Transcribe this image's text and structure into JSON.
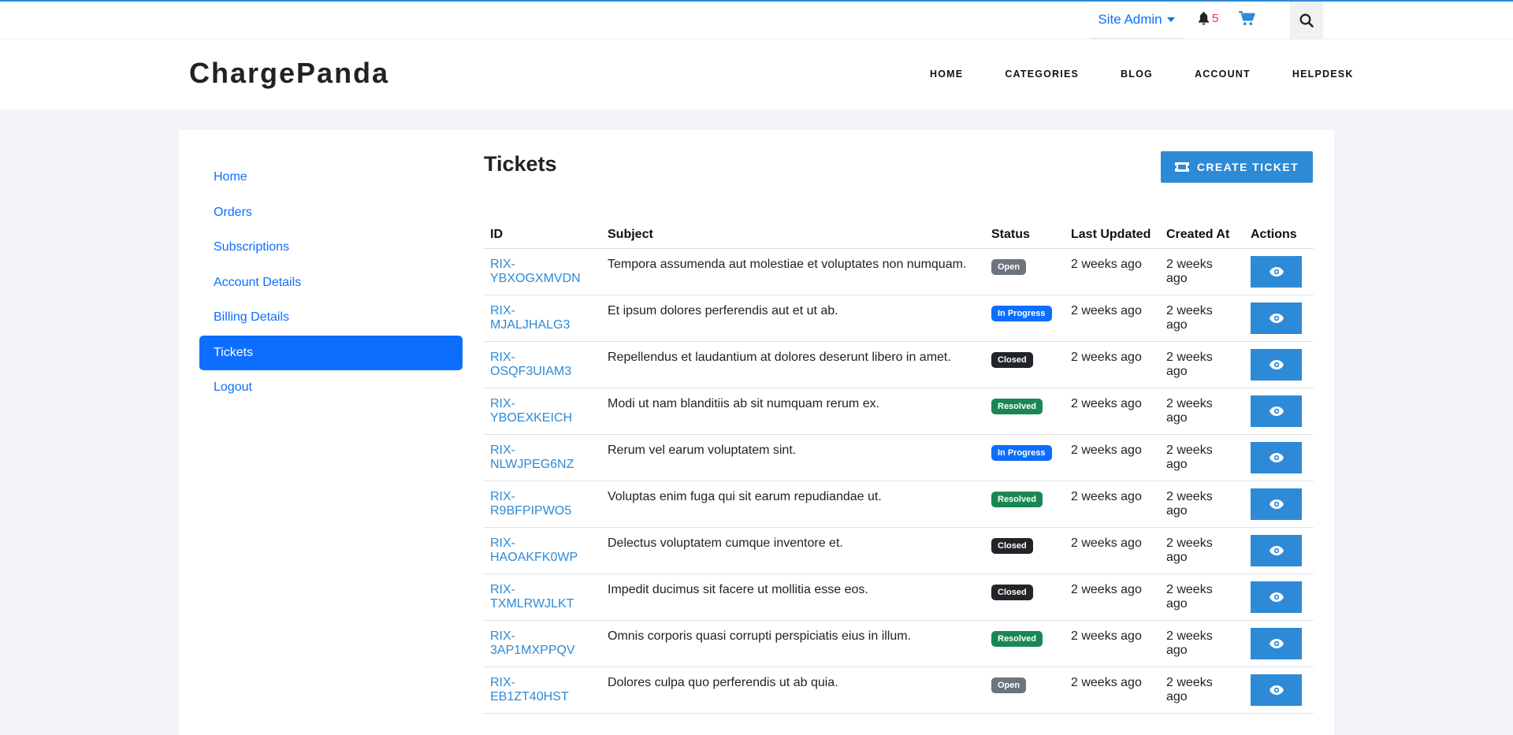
{
  "topbar": {
    "user_menu": "Site Admin",
    "notification_count": "5"
  },
  "header": {
    "logo": "ChargePanda",
    "nav": [
      "HOME",
      "CATEGORIES",
      "BLOG",
      "ACCOUNT",
      "HELPDESK"
    ]
  },
  "sidebar": {
    "items": [
      {
        "label": "Home",
        "active": false
      },
      {
        "label": "Orders",
        "active": false
      },
      {
        "label": "Subscriptions",
        "active": false
      },
      {
        "label": "Account Details",
        "active": false
      },
      {
        "label": "Billing Details",
        "active": false
      },
      {
        "label": "Tickets",
        "active": true
      },
      {
        "label": "Logout",
        "active": false
      }
    ]
  },
  "main": {
    "title": "Tickets",
    "create_button": "CREATE TICKET",
    "columns": [
      "ID",
      "Subject",
      "Status",
      "Last Updated",
      "Created At",
      "Actions"
    ],
    "rows": [
      {
        "id": "RIX-YBXOGXMVDN",
        "subject": "Tempora assumenda aut molestiae et voluptates non numquam.",
        "status": "Open",
        "updated": "2 weeks ago",
        "created": "2 weeks ago"
      },
      {
        "id": "RIX-MJALJHALG3",
        "subject": "Et ipsum dolores perferendis aut et ut ab.",
        "status": "In Progress",
        "updated": "2 weeks ago",
        "created": "2 weeks ago"
      },
      {
        "id": "RIX-OSQF3UIAM3",
        "subject": "Repellendus et laudantium at dolores deserunt libero in amet.",
        "status": "Closed",
        "updated": "2 weeks ago",
        "created": "2 weeks ago"
      },
      {
        "id": "RIX-YBOEXKEICH",
        "subject": "Modi ut nam blanditiis ab sit numquam rerum ex.",
        "status": "Resolved",
        "updated": "2 weeks ago",
        "created": "2 weeks ago"
      },
      {
        "id": "RIX-NLWJPEG6NZ",
        "subject": "Rerum vel earum voluptatem sint.",
        "status": "In Progress",
        "updated": "2 weeks ago",
        "created": "2 weeks ago"
      },
      {
        "id": "RIX-R9BFPIPWO5",
        "subject": "Voluptas enim fuga qui sit earum repudiandae ut.",
        "status": "Resolved",
        "updated": "2 weeks ago",
        "created": "2 weeks ago"
      },
      {
        "id": "RIX-HAOAKFK0WP",
        "subject": "Delectus voluptatem cumque inventore et.",
        "status": "Closed",
        "updated": "2 weeks ago",
        "created": "2 weeks ago"
      },
      {
        "id": "RIX-TXMLRWJLKT",
        "subject": "Impedit ducimus sit facere ut mollitia esse eos.",
        "status": "Closed",
        "updated": "2 weeks ago",
        "created": "2 weeks ago"
      },
      {
        "id": "RIX-3AP1MXPPQV",
        "subject": "Omnis corporis quasi corrupti perspiciatis eius in illum.",
        "status": "Resolved",
        "updated": "2 weeks ago",
        "created": "2 weeks ago"
      },
      {
        "id": "RIX-EB1ZT40HST",
        "subject": "Dolores culpa quo perferendis ut ab quia.",
        "status": "Open",
        "updated": "2 weeks ago",
        "created": "2 weeks ago"
      }
    ]
  },
  "status_colors": {
    "Open": "#6c757d",
    "In Progress": "#0d6efd",
    "Closed": "#212529",
    "Resolved": "#198754"
  },
  "icons": {
    "notification": "bell-icon",
    "cart": "cart-icon",
    "search": "search-icon",
    "create_ticket": "ticket-icon",
    "view": "eye-icon"
  },
  "colors": {
    "accent": "#2d8ad6",
    "link": "#0d6efd",
    "background": "#f2f4f8"
  }
}
